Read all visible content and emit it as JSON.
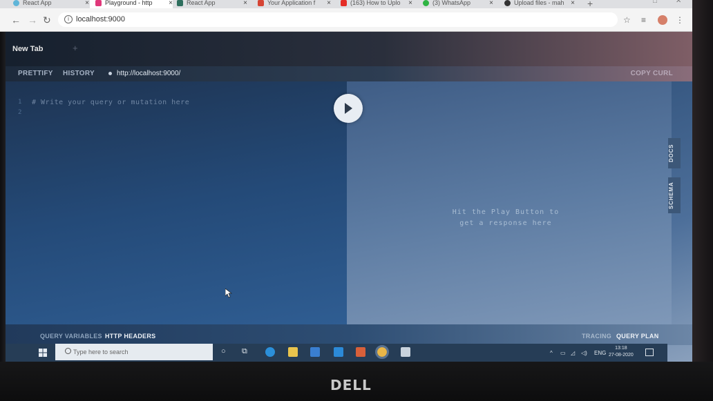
{
  "browser": {
    "tabs": [
      {
        "title": "React App",
        "icon": "react-icon",
        "color": "#5fb5d8"
      },
      {
        "title": "Playground - http",
        "icon": "playground-icon",
        "color": "#e0387a"
      },
      {
        "title": "React App",
        "icon": "react-icon",
        "color": "#2f6f5e"
      },
      {
        "title": "Your Application f",
        "icon": "gmail-icon",
        "color": "#d64535"
      },
      {
        "title": "(163) How to Uplo",
        "icon": "youtube-icon",
        "color": "#e52d27"
      },
      {
        "title": "(3) WhatsApp",
        "icon": "whatsapp-icon",
        "color": "#2fb443"
      },
      {
        "title": "Upload files - mah",
        "icon": "github-icon",
        "color": "#333333"
      }
    ],
    "url": "localhost:9000"
  },
  "playground": {
    "tab_title": "New Tab",
    "prettify": "PRETTIFY",
    "history": "HISTORY",
    "endpoint": "http://localhost:9000/",
    "copy_curl": "COPY CURL",
    "line_numbers": [
      "1",
      "2"
    ],
    "editor_placeholder": "# Write your query or mutation here",
    "result_hint_line1": "Hit the Play Button to",
    "result_hint_line2": "get a response here",
    "docs": "DOCS",
    "schema": "SCHEMA",
    "query_variables": "QUERY VARIABLES",
    "http_headers": "HTTP HEADERS",
    "tracing": "TRACING",
    "query_plan": "QUERY PLAN"
  },
  "taskbar": {
    "search_placeholder": "Type here to search",
    "language": "ENG",
    "time": "13:18",
    "date": "27-08-2020"
  },
  "monitor": {
    "brand": "DELL"
  }
}
